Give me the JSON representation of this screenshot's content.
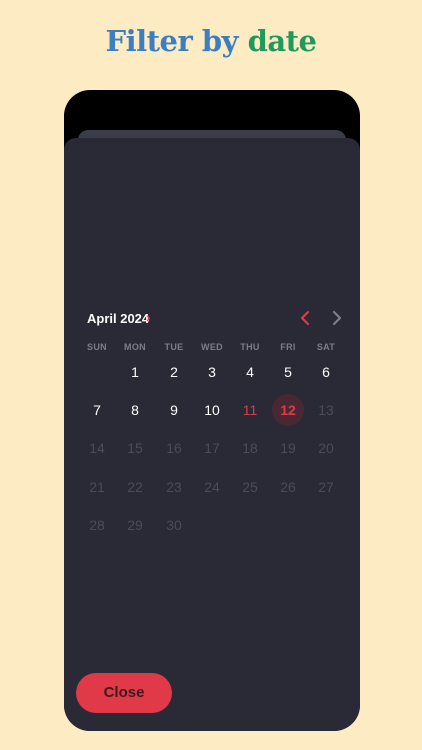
{
  "headline": {
    "part1": "Filter by",
    "part2": "date"
  },
  "calendar": {
    "month_label": "April 2024",
    "month_chevron": "›",
    "weekdays": [
      "SUN",
      "MON",
      "TUE",
      "WED",
      "THU",
      "FRI",
      "SAT"
    ],
    "days": [
      "1",
      "2",
      "3",
      "4",
      "5",
      "6",
      "7",
      "8",
      "9",
      "10",
      "11",
      "12",
      "13",
      "14",
      "15",
      "16",
      "17",
      "18",
      "19",
      "20",
      "21",
      "22",
      "23",
      "24",
      "25",
      "26",
      "27",
      "28",
      "29",
      "30"
    ],
    "today": "11",
    "selected": "12",
    "enabled_through": "12",
    "colors": {
      "accent": "#e03a49",
      "selected_bg": "#4a2833",
      "sheet_bg": "#292a36"
    }
  },
  "icons": {
    "prev": "chevron-left-icon",
    "next": "chevron-right-icon"
  },
  "close_button": {
    "label": "Close"
  }
}
